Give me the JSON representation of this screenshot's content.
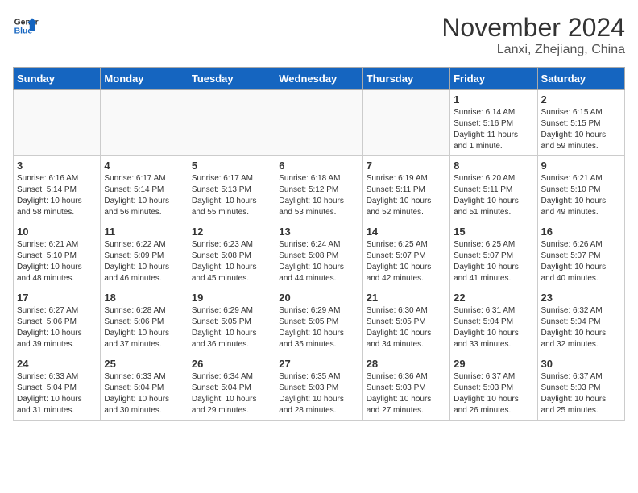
{
  "header": {
    "logo_line1": "General",
    "logo_line2": "Blue",
    "month": "November 2024",
    "location": "Lanxi, Zhejiang, China"
  },
  "weekdays": [
    "Sunday",
    "Monday",
    "Tuesday",
    "Wednesday",
    "Thursday",
    "Friday",
    "Saturday"
  ],
  "weeks": [
    [
      {
        "day": "",
        "info": ""
      },
      {
        "day": "",
        "info": ""
      },
      {
        "day": "",
        "info": ""
      },
      {
        "day": "",
        "info": ""
      },
      {
        "day": "",
        "info": ""
      },
      {
        "day": "1",
        "info": "Sunrise: 6:14 AM\nSunset: 5:16 PM\nDaylight: 11 hours\nand 1 minute."
      },
      {
        "day": "2",
        "info": "Sunrise: 6:15 AM\nSunset: 5:15 PM\nDaylight: 10 hours\nand 59 minutes."
      }
    ],
    [
      {
        "day": "3",
        "info": "Sunrise: 6:16 AM\nSunset: 5:14 PM\nDaylight: 10 hours\nand 58 minutes."
      },
      {
        "day": "4",
        "info": "Sunrise: 6:17 AM\nSunset: 5:14 PM\nDaylight: 10 hours\nand 56 minutes."
      },
      {
        "day": "5",
        "info": "Sunrise: 6:17 AM\nSunset: 5:13 PM\nDaylight: 10 hours\nand 55 minutes."
      },
      {
        "day": "6",
        "info": "Sunrise: 6:18 AM\nSunset: 5:12 PM\nDaylight: 10 hours\nand 53 minutes."
      },
      {
        "day": "7",
        "info": "Sunrise: 6:19 AM\nSunset: 5:11 PM\nDaylight: 10 hours\nand 52 minutes."
      },
      {
        "day": "8",
        "info": "Sunrise: 6:20 AM\nSunset: 5:11 PM\nDaylight: 10 hours\nand 51 minutes."
      },
      {
        "day": "9",
        "info": "Sunrise: 6:21 AM\nSunset: 5:10 PM\nDaylight: 10 hours\nand 49 minutes."
      }
    ],
    [
      {
        "day": "10",
        "info": "Sunrise: 6:21 AM\nSunset: 5:10 PM\nDaylight: 10 hours\nand 48 minutes."
      },
      {
        "day": "11",
        "info": "Sunrise: 6:22 AM\nSunset: 5:09 PM\nDaylight: 10 hours\nand 46 minutes."
      },
      {
        "day": "12",
        "info": "Sunrise: 6:23 AM\nSunset: 5:08 PM\nDaylight: 10 hours\nand 45 minutes."
      },
      {
        "day": "13",
        "info": "Sunrise: 6:24 AM\nSunset: 5:08 PM\nDaylight: 10 hours\nand 44 minutes."
      },
      {
        "day": "14",
        "info": "Sunrise: 6:25 AM\nSunset: 5:07 PM\nDaylight: 10 hours\nand 42 minutes."
      },
      {
        "day": "15",
        "info": "Sunrise: 6:25 AM\nSunset: 5:07 PM\nDaylight: 10 hours\nand 41 minutes."
      },
      {
        "day": "16",
        "info": "Sunrise: 6:26 AM\nSunset: 5:07 PM\nDaylight: 10 hours\nand 40 minutes."
      }
    ],
    [
      {
        "day": "17",
        "info": "Sunrise: 6:27 AM\nSunset: 5:06 PM\nDaylight: 10 hours\nand 39 minutes."
      },
      {
        "day": "18",
        "info": "Sunrise: 6:28 AM\nSunset: 5:06 PM\nDaylight: 10 hours\nand 37 minutes."
      },
      {
        "day": "19",
        "info": "Sunrise: 6:29 AM\nSunset: 5:05 PM\nDaylight: 10 hours\nand 36 minutes."
      },
      {
        "day": "20",
        "info": "Sunrise: 6:29 AM\nSunset: 5:05 PM\nDaylight: 10 hours\nand 35 minutes."
      },
      {
        "day": "21",
        "info": "Sunrise: 6:30 AM\nSunset: 5:05 PM\nDaylight: 10 hours\nand 34 minutes."
      },
      {
        "day": "22",
        "info": "Sunrise: 6:31 AM\nSunset: 5:04 PM\nDaylight: 10 hours\nand 33 minutes."
      },
      {
        "day": "23",
        "info": "Sunrise: 6:32 AM\nSunset: 5:04 PM\nDaylight: 10 hours\nand 32 minutes."
      }
    ],
    [
      {
        "day": "24",
        "info": "Sunrise: 6:33 AM\nSunset: 5:04 PM\nDaylight: 10 hours\nand 31 minutes."
      },
      {
        "day": "25",
        "info": "Sunrise: 6:33 AM\nSunset: 5:04 PM\nDaylight: 10 hours\nand 30 minutes."
      },
      {
        "day": "26",
        "info": "Sunrise: 6:34 AM\nSunset: 5:04 PM\nDaylight: 10 hours\nand 29 minutes."
      },
      {
        "day": "27",
        "info": "Sunrise: 6:35 AM\nSunset: 5:03 PM\nDaylight: 10 hours\nand 28 minutes."
      },
      {
        "day": "28",
        "info": "Sunrise: 6:36 AM\nSunset: 5:03 PM\nDaylight: 10 hours\nand 27 minutes."
      },
      {
        "day": "29",
        "info": "Sunrise: 6:37 AM\nSunset: 5:03 PM\nDaylight: 10 hours\nand 26 minutes."
      },
      {
        "day": "30",
        "info": "Sunrise: 6:37 AM\nSunset: 5:03 PM\nDaylight: 10 hours\nand 25 minutes."
      }
    ]
  ]
}
